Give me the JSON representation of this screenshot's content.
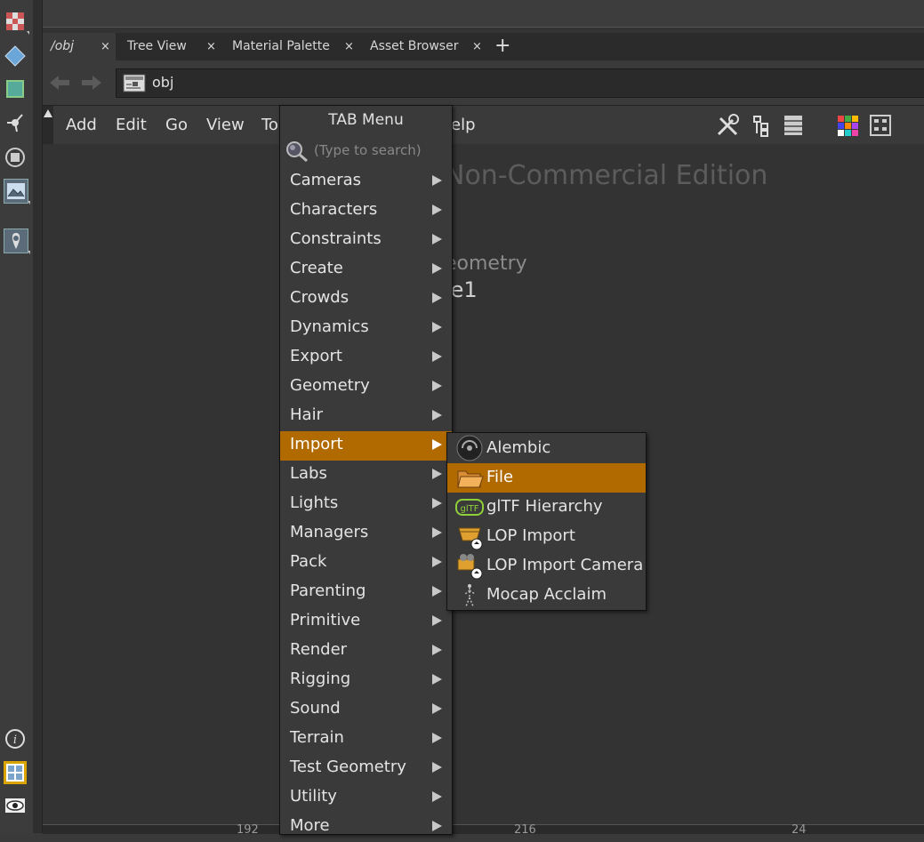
{
  "tabs": [
    {
      "label": "/obj",
      "close": "×"
    },
    {
      "label": "Tree View",
      "close": "×"
    },
    {
      "label": "Material Palette",
      "close": "×"
    },
    {
      "label": "Asset Browser",
      "close": "×"
    }
  ],
  "add_tab": "+",
  "path": {
    "value": "obj"
  },
  "menubar": {
    "items": [
      "Add",
      "Edit",
      "Go",
      "View",
      "To",
      "elp"
    ]
  },
  "canvas": {
    "watermark": "Non-Commercial Edition",
    "node_type": "eometry",
    "node_name": "le1"
  },
  "ruler": [
    "192",
    "216",
    "24"
  ],
  "tab_menu": {
    "title": "TAB Menu",
    "search_placeholder": "(Type to search)",
    "items": [
      {
        "label": "Cameras"
      },
      {
        "label": "Characters"
      },
      {
        "label": "Constraints"
      },
      {
        "label": "Create"
      },
      {
        "label": "Crowds"
      },
      {
        "label": "Dynamics"
      },
      {
        "label": "Export"
      },
      {
        "label": "Geometry"
      },
      {
        "label": "Hair"
      },
      {
        "label": "Import"
      },
      {
        "label": "Labs"
      },
      {
        "label": "Lights"
      },
      {
        "label": "Managers"
      },
      {
        "label": "Pack"
      },
      {
        "label": "Parenting"
      },
      {
        "label": "Primitive"
      },
      {
        "label": "Render"
      },
      {
        "label": "Rigging"
      },
      {
        "label": "Sound"
      },
      {
        "label": "Terrain"
      },
      {
        "label": "Test Geometry"
      },
      {
        "label": "Utility"
      },
      {
        "label": "More"
      }
    ],
    "selected": "Import"
  },
  "submenu": {
    "items": [
      {
        "label": "Alembic",
        "icon": "alembic-icon"
      },
      {
        "label": "File",
        "icon": "folder-icon"
      },
      {
        "label": "glTF Hierarchy",
        "icon": "gltf-icon"
      },
      {
        "label": "LOP Import",
        "icon": "lop-import-icon"
      },
      {
        "label": "LOP Import Camera",
        "icon": "lop-import-camera-icon"
      },
      {
        "label": "Mocap Acclaim",
        "icon": "mocap-icon"
      }
    ],
    "selected": "File"
  },
  "colors": {
    "highlight": "#b06a00",
    "background": "#3a3a3a",
    "canvas": "#333333"
  }
}
